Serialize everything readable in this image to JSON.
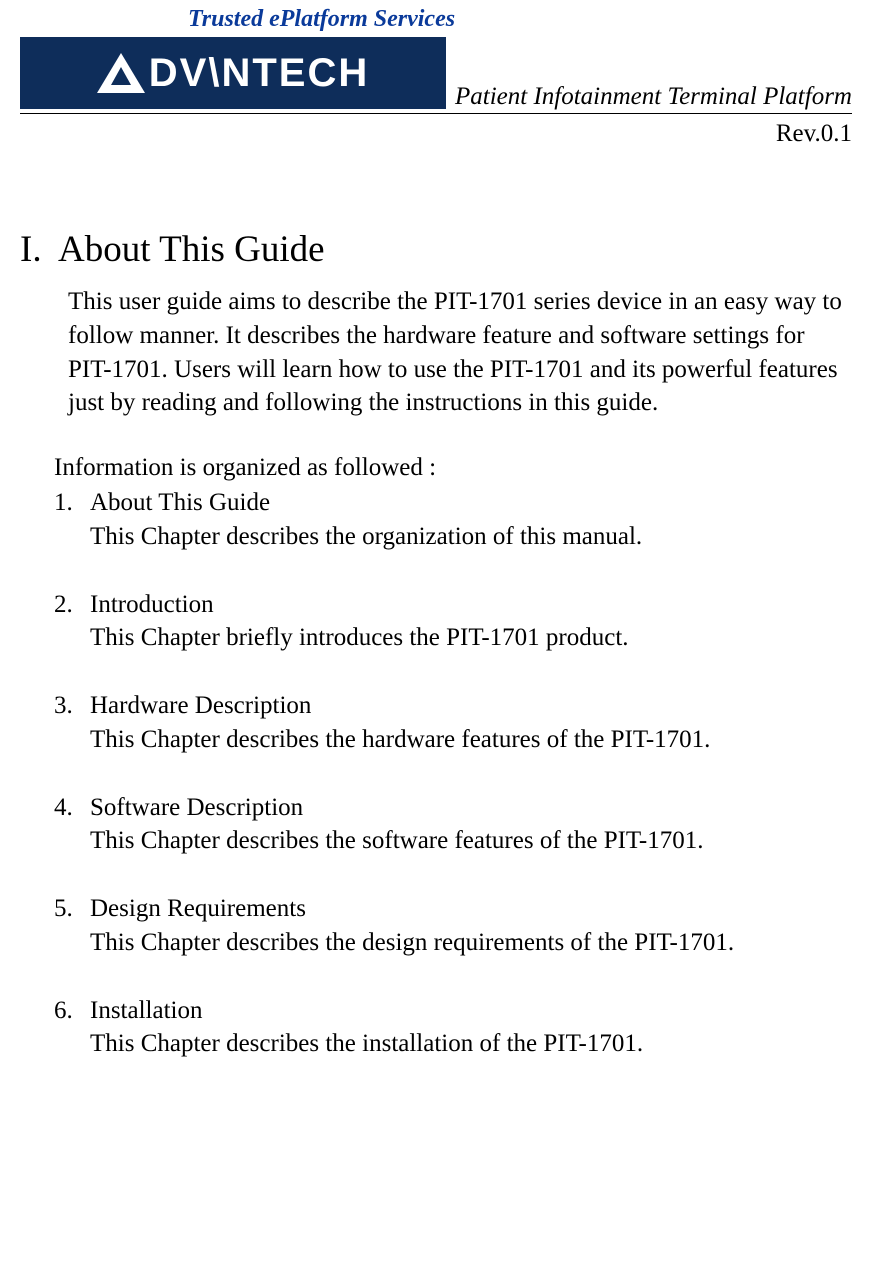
{
  "header": {
    "tagline": "Trusted ePlatform Services",
    "logo_text": "DV\\NTECH",
    "doc_title": "Patient Infotainment Terminal Platform",
    "revision": "Rev.0.1"
  },
  "section": {
    "number": "I.",
    "title": "About This Guide",
    "intro": "This user guide aims to describe the PIT-1701 series device in an easy way to follow manner. It describes the hardware feature and software settings for PIT-1701. Users will learn how to use the PIT-1701 and its powerful features just by reading and following the instructions in this guide.",
    "org_intro": "Information is organized as followed :",
    "chapters": [
      {
        "title": "About This Guide",
        "desc": "This Chapter describes the organization of this manual."
      },
      {
        "title": "Introduction",
        "desc": "This Chapter briefly introduces the PIT-1701 product."
      },
      {
        "title": "Hardware Description",
        "desc": "This Chapter describes the hardware features of the PIT-1701."
      },
      {
        "title": "Software Description",
        "desc": "This Chapter describes the software features of the PIT-1701."
      },
      {
        "title": "Design Requirements",
        "desc": "This Chapter describes the design requirements of the PIT-1701."
      },
      {
        "title": "Installation",
        "desc": "This Chapter describes the installation of the PIT-1701."
      }
    ]
  }
}
